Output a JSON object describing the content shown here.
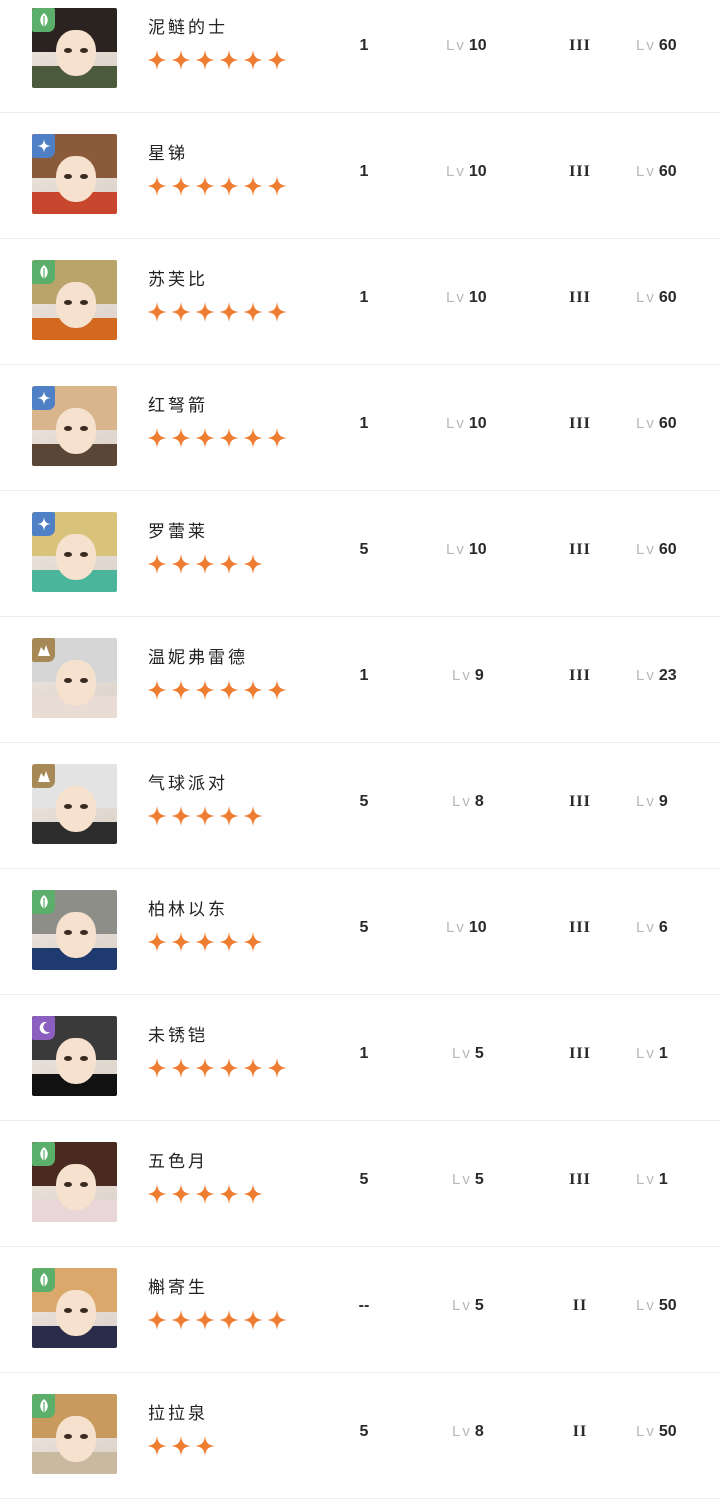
{
  "level_prefix": "Lv",
  "characters": [
    {
      "name": "泥鲢的士",
      "stars": 6,
      "element": "leaf",
      "count": "1",
      "level": "10",
      "rank": "III",
      "skill_level": "60",
      "colors": {
        "hair": "#2b2320",
        "outfit": "#4a5a3a"
      }
    },
    {
      "name": "星锑",
      "stars": 6,
      "element": "star",
      "count": "1",
      "level": "10",
      "rank": "III",
      "skill_level": "60",
      "colors": {
        "hair": "#8a5a3a",
        "outfit": "#c8462e"
      }
    },
    {
      "name": "苏芙比",
      "stars": 6,
      "element": "leaf",
      "count": "1",
      "level": "10",
      "rank": "III",
      "skill_level": "60",
      "colors": {
        "hair": "#b9a46a",
        "outfit": "#d4681f"
      }
    },
    {
      "name": "红弩箭",
      "stars": 6,
      "element": "star",
      "count": "1",
      "level": "10",
      "rank": "III",
      "skill_level": "60",
      "colors": {
        "hair": "#d8b58a",
        "outfit": "#5a4636"
      }
    },
    {
      "name": "罗蕾莱",
      "stars": 5,
      "element": "star",
      "count": "5",
      "level": "10",
      "rank": "III",
      "skill_level": "60",
      "colors": {
        "hair": "#d9c27a",
        "outfit": "#4bb59c"
      }
    },
    {
      "name": "温妮弗雷德",
      "stars": 6,
      "element": "beast",
      "count": "1",
      "level": "9",
      "rank": "III",
      "skill_level": "23",
      "colors": {
        "hair": "#d6d6d6",
        "outfit": "#e8dcd4"
      }
    },
    {
      "name": "气球派对",
      "stars": 5,
      "element": "beast",
      "count": "5",
      "level": "8",
      "rank": "III",
      "skill_level": "9",
      "colors": {
        "hair": "#e3e3e3",
        "outfit": "#2d2d2d"
      }
    },
    {
      "name": "柏林以东",
      "stars": 5,
      "element": "leaf",
      "count": "5",
      "level": "10",
      "rank": "III",
      "skill_level": "6",
      "colors": {
        "hair": "#8e8e88",
        "outfit": "#1f3a6e"
      }
    },
    {
      "name": "未锈铠",
      "stars": 6,
      "element": "moon",
      "count": "1",
      "level": "5",
      "rank": "III",
      "skill_level": "1",
      "colors": {
        "hair": "#3a3a3a",
        "outfit": "#111111"
      }
    },
    {
      "name": "五色月",
      "stars": 5,
      "element": "leaf",
      "count": "5",
      "level": "5",
      "rank": "III",
      "skill_level": "1",
      "colors": {
        "hair": "#4a2a20",
        "outfit": "#e9d6d8"
      }
    },
    {
      "name": "槲寄生",
      "stars": 6,
      "element": "leaf",
      "count": "--",
      "level": "5",
      "rank": "II",
      "skill_level": "50",
      "colors": {
        "hair": "#d9a86a",
        "outfit": "#2a2d4a"
      }
    },
    {
      "name": "拉拉泉",
      "stars": 3,
      "element": "leaf",
      "count": "5",
      "level": "8",
      "rank": "II",
      "skill_level": "50",
      "colors": {
        "hair": "#c99a5e",
        "outfit": "#c9b9a0"
      }
    }
  ],
  "element_colors": {
    "leaf": "#5cae6b",
    "star": "#4f80c6",
    "beast": "#a78957",
    "moon": "#8b5fbf"
  },
  "star_color": "#ee7d31"
}
